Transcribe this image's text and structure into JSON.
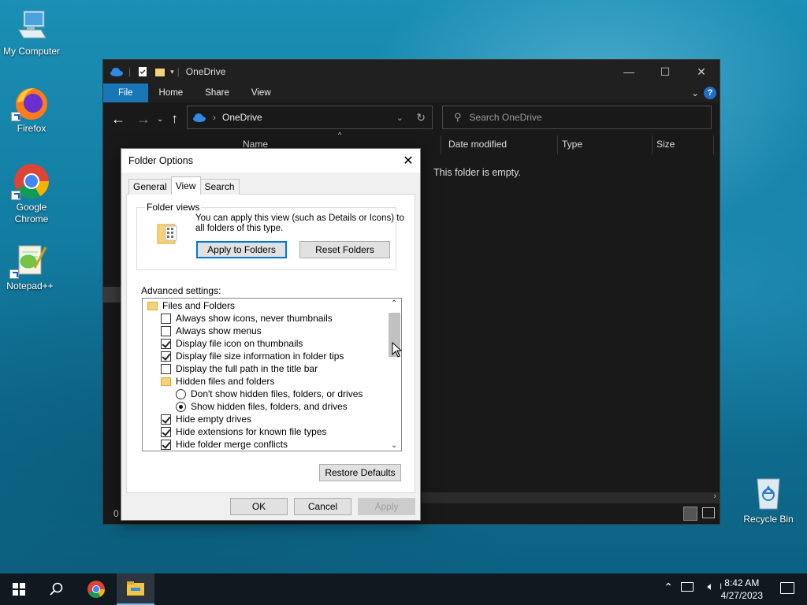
{
  "desktop": {
    "icons": [
      {
        "label": "My Computer"
      },
      {
        "label": "Firefox"
      },
      {
        "label": "Google Chrome"
      },
      {
        "label": "Notepad++"
      },
      {
        "label": "Recycle Bin"
      }
    ]
  },
  "explorer": {
    "title": "OneDrive",
    "ribbon_tabs": [
      "File",
      "Home",
      "Share",
      "View"
    ],
    "address": "OneDrive",
    "search_placeholder": "Search OneDrive",
    "columns": [
      "Name",
      "Date modified",
      "Type",
      "Size"
    ],
    "empty_message": "This folder is empty.",
    "status_count": "0"
  },
  "dialog": {
    "title": "Folder Options",
    "tabs": [
      "General",
      "View",
      "Search"
    ],
    "active_tab": "View",
    "folder_views": {
      "label": "Folder views",
      "description_line1": "You can apply this view (such as Details or Icons) to",
      "description_line2": "all folders of this type.",
      "apply_button": "Apply to Folders",
      "reset_button": "Reset Folders"
    },
    "advanced_label": "Advanced settings:",
    "settings": [
      {
        "type": "folder",
        "label": "Files and Folders",
        "indent": 0
      },
      {
        "type": "checkbox",
        "label": "Always show icons, never thumbnails",
        "checked": false,
        "indent": 1
      },
      {
        "type": "checkbox",
        "label": "Always show menus",
        "checked": false,
        "indent": 1
      },
      {
        "type": "checkbox",
        "label": "Display file icon on thumbnails",
        "checked": true,
        "indent": 1
      },
      {
        "type": "checkbox",
        "label": "Display file size information in folder tips",
        "checked": true,
        "indent": 1
      },
      {
        "type": "checkbox",
        "label": "Display the full path in the title bar",
        "checked": false,
        "indent": 1
      },
      {
        "type": "folder",
        "label": "Hidden files and folders",
        "indent": 1
      },
      {
        "type": "radio",
        "label": "Don't show hidden files, folders, or drives",
        "checked": false,
        "indent": 2
      },
      {
        "type": "radio",
        "label": "Show hidden files, folders, and drives",
        "checked": true,
        "indent": 2
      },
      {
        "type": "checkbox",
        "label": "Hide empty drives",
        "checked": true,
        "indent": 1
      },
      {
        "type": "checkbox",
        "label": "Hide extensions for known file types",
        "checked": true,
        "indent": 1
      },
      {
        "type": "checkbox",
        "label": "Hide folder merge conflicts",
        "checked": true,
        "indent": 1
      }
    ],
    "restore_button": "Restore Defaults",
    "ok_button": "OK",
    "cancel_button": "Cancel",
    "apply_button": "Apply"
  },
  "taskbar": {
    "time": "8:42 AM",
    "date": "4/27/2023"
  },
  "colors": {
    "accent": "#1976b7",
    "explorer_bg": "#191919",
    "taskbar_bg": "#101820"
  }
}
